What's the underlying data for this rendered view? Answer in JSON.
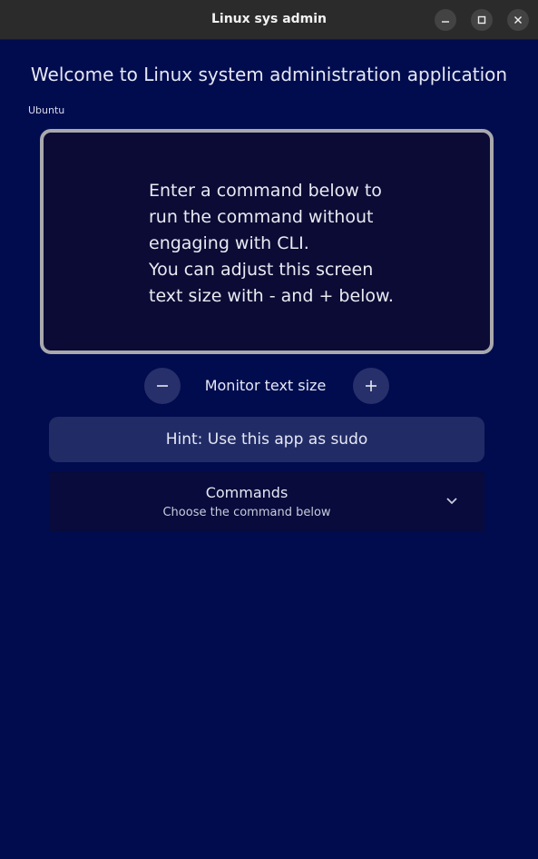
{
  "window": {
    "title": "Linux sys admin",
    "controls": [
      "minimize-icon",
      "maximize-icon",
      "close-icon"
    ]
  },
  "main": {
    "welcome": "Welcome to Linux system administration application",
    "distro": "Ubuntu",
    "monitor_text": "Enter a command below to\nrun the command without\nengaging with CLI.\nYou can adjust this screen\ntext size with - and + below.",
    "text_size_label": "Monitor text size",
    "hint": "Hint: Use this app as sudo",
    "commands": {
      "title": "Commands",
      "subtitle": "Choose the command below"
    }
  },
  "colors": {
    "background": "#010c4f",
    "titlebar": "#2b2b2b",
    "monitor_bg": "#0b0b35",
    "monitor_border": "#a9a9ad",
    "button": "#27306a",
    "hint_bg": "#212c66",
    "dropdown_bg": "#080b3b"
  }
}
